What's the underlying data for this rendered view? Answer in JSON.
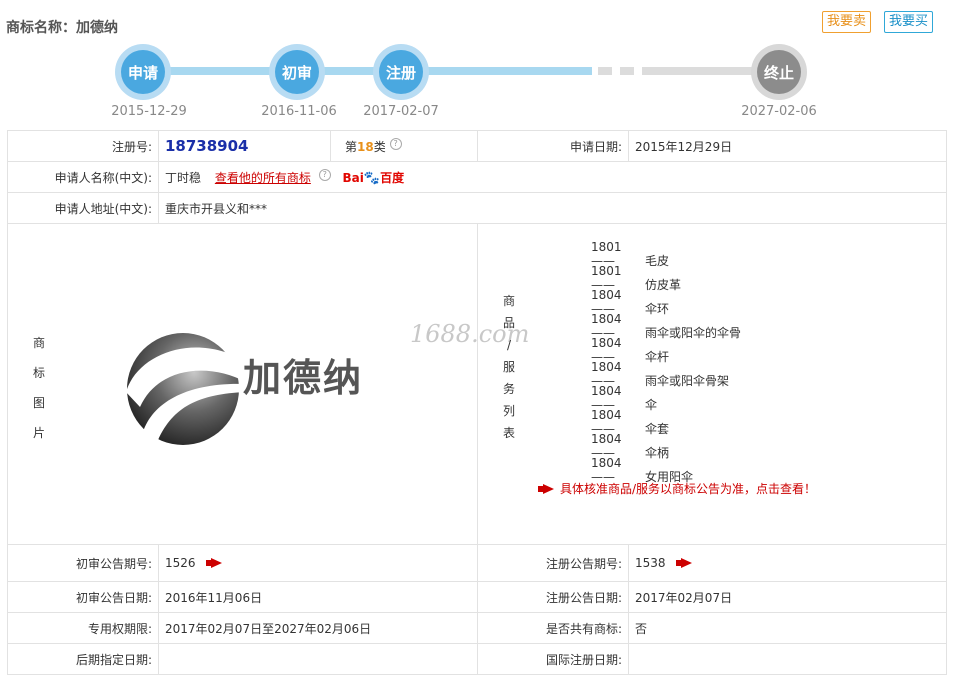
{
  "header": {
    "label": "商标名称：",
    "name": "加德纳",
    "sell_btn": "我要卖",
    "buy_btn": "我要买"
  },
  "timeline": [
    {
      "label": "申请",
      "date": "2015-12-29",
      "status": "done"
    },
    {
      "label": "初审",
      "date": "2016-11-06",
      "status": "done"
    },
    {
      "label": "注册",
      "date": "2017-02-07",
      "status": "done"
    },
    {
      "label": "终止",
      "date": "2027-02-06",
      "status": "pending"
    }
  ],
  "info": {
    "reg_no_label": "注册号:",
    "reg_no": "18738904",
    "class_prefix": "第",
    "class_num": "18",
    "class_suffix": "类",
    "apply_date_label": "申请日期:",
    "apply_date": "2015年12月29日",
    "applicant_label": "申请人名称(中文):",
    "applicant": "丁时稳",
    "all_marks_link": "查看他的所有商标",
    "baidu_1": "Bai",
    "baidu_2": "百度",
    "address_label": "申请人地址(中文):",
    "address": "重庆市开县义和***",
    "image_label": [
      "商",
      "标",
      "图",
      "片"
    ],
    "logo_text": "加德纳",
    "watermark": "1688.com",
    "goods_label": [
      "商",
      "品",
      "/",
      "服",
      "务",
      "列",
      "表"
    ],
    "goods": [
      {
        "code": "1801——",
        "name": "毛皮"
      },
      {
        "code": "1801——",
        "name": "仿皮革"
      },
      {
        "code": "1804——",
        "name": "伞环"
      },
      {
        "code": "1804——",
        "name": "雨伞或阳伞的伞骨"
      },
      {
        "code": "1804——",
        "name": "伞杆"
      },
      {
        "code": "1804——",
        "name": "雨伞或阳伞骨架"
      },
      {
        "code": "1804——",
        "name": "伞"
      },
      {
        "code": "1804——",
        "name": "伞套"
      },
      {
        "code": "1804——",
        "name": "伞柄"
      },
      {
        "code": "1804——",
        "name": "女用阳伞"
      }
    ],
    "goods_notice": "具体核准商品/服务以商标公告为准，点击查看！",
    "prelim_no_label": "初审公告期号:",
    "prelim_no": "1526",
    "reg_pub_no_label": "注册公告期号:",
    "reg_pub_no": "1538",
    "prelim_date_label": "初审公告日期:",
    "prelim_date": "2016年11月06日",
    "reg_pub_date_label": "注册公告日期:",
    "reg_pub_date": "2017年02月07日",
    "exclusive_label": "专用权期限:",
    "exclusive": "2017年02月07日至2027年02月06日",
    "shared_label": "是否共有商标:",
    "shared": "否",
    "later_label": "后期指定日期:",
    "later": "",
    "intl_label": "国际注册日期:",
    "intl": ""
  },
  "colors": {
    "accent_blue": "#4aa8e0",
    "pending_grey": "#8c8c8c",
    "link_red": "#cc0000",
    "reg_no_blue": "#1a2fa8",
    "class_orange": "#e8901a"
  }
}
